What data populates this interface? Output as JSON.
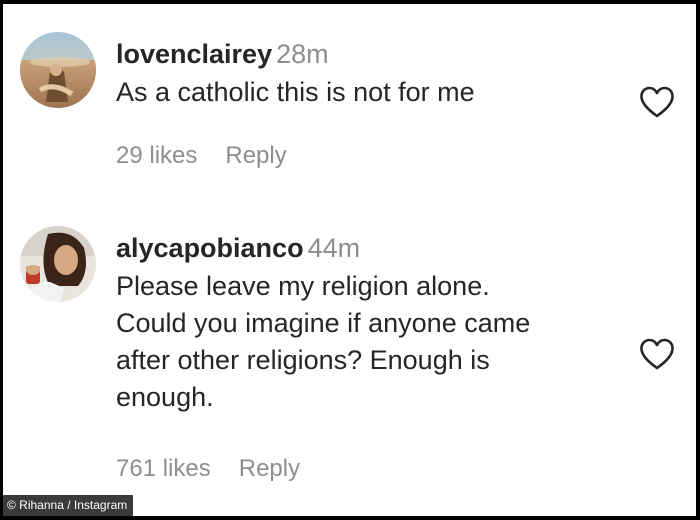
{
  "comments": [
    {
      "username": "lovenclairey",
      "time": "28m",
      "lines": [
        "As a catholic this is not for me"
      ],
      "likes": "29 likes",
      "reply": "Reply",
      "like_icon": "heart-outline-icon"
    },
    {
      "username": "alycapobianco",
      "time": "44m",
      "lines": [
        "Please leave my religion alone.",
        "Could you imagine if anyone came",
        "after other religions? Enough is",
        "enough."
      ],
      "likes": "761 likes",
      "reply": "Reply",
      "like_icon": "heart-outline-icon"
    }
  ],
  "credit": "© Rihanna / Instagram",
  "colors": {
    "text": "#262626",
    "secondary": "#8e8e8e",
    "background": "#ffffff",
    "frame": "#000000"
  }
}
